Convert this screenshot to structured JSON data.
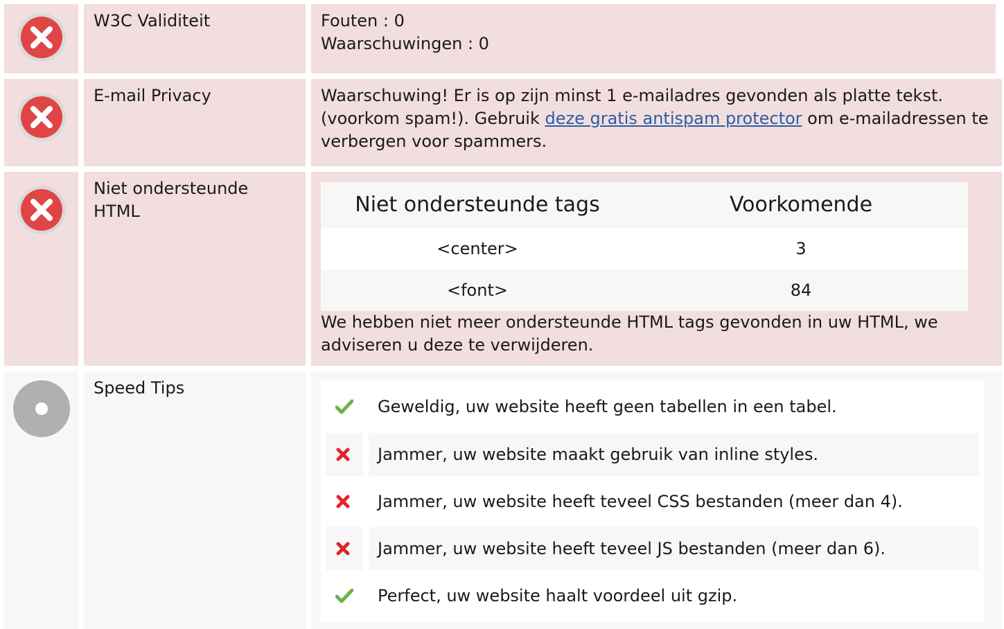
{
  "colors": {
    "error": "#e04545",
    "neutral": "#b0b0b1",
    "check": "#6bb346",
    "cross": "#e0242b",
    "link": "#2b5ea7"
  },
  "rows": [
    {
      "status_icon": "error-icon",
      "label": "W3C Validiteit",
      "lines": [
        "Fouten : 0",
        "Waarschuwingen : 0"
      ]
    },
    {
      "status_icon": "error-icon",
      "label": "E-mail Privacy",
      "text_before": "Waarschuwing! Er is op zijn minst 1 e-mailadres gevonden als platte tekst. (voorkom spam!). Gebruik ",
      "link_text": "deze gratis antispam protector",
      "text_after": " om e-mailadressen te verbergen voor spammers."
    },
    {
      "status_icon": "error-icon",
      "label": "Niet ondersteunde HTML",
      "table": {
        "headers": [
          "Niet ondersteunde tags",
          "Voorkomende"
        ],
        "rows": [
          {
            "tag": "<center>",
            "count": "3"
          },
          {
            "tag": "<font>",
            "count": "84"
          }
        ]
      },
      "note": "We hebben niet meer ondersteunde HTML tags gevonden in uw HTML, we adviseren u deze te verwijderen."
    },
    {
      "status_icon": "neutral-icon",
      "label": "Speed Tips",
      "tips": [
        {
          "status": "check-icon",
          "text": "Geweldig, uw website heeft geen tabellen in een tabel."
        },
        {
          "status": "cross-icon",
          "text": "Jammer, uw website maakt gebruik van inline styles."
        },
        {
          "status": "cross-icon",
          "text": "Jammer, uw website heeft teveel CSS bestanden (meer dan 4)."
        },
        {
          "status": "cross-icon",
          "text": "Jammer, uw website heeft teveel JS bestanden (meer dan 6)."
        },
        {
          "status": "check-icon",
          "text": "Perfect, uw website haalt voordeel uit gzip."
        }
      ]
    }
  ]
}
